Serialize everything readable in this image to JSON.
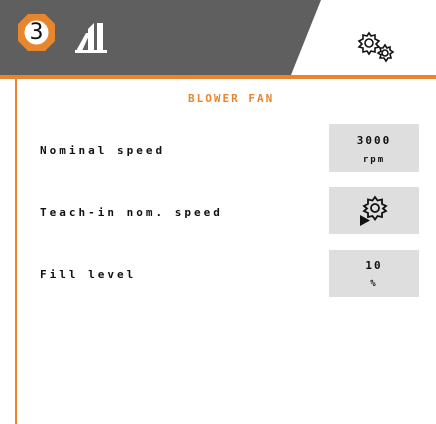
{
  "header": {
    "step_number": "3",
    "logo_icon": "machine-logo-icon",
    "settings_icon": "gears-icon",
    "accent_color": "#e8862e",
    "bar_color": "#5f5f5f"
  },
  "screen": {
    "title": "BLOWER FAN"
  },
  "rows": [
    {
      "label": "Nominal speed",
      "value": "3000",
      "unit": "rpm"
    },
    {
      "label": "Teach-in nom. speed",
      "icon": "gear-play-icon"
    },
    {
      "label": "Fill level",
      "value": "10",
      "unit": "%"
    }
  ]
}
